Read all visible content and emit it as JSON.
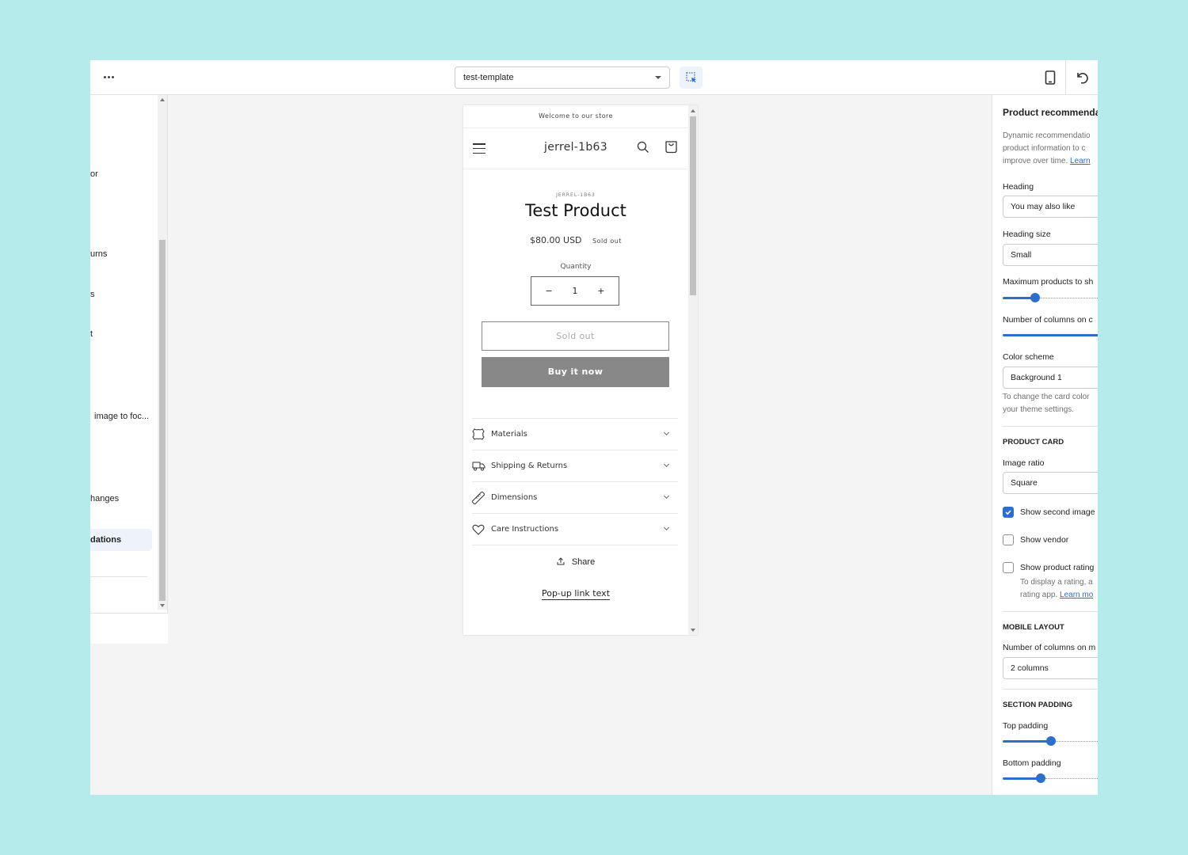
{
  "topbar": {
    "more_icon": "ellipsis-icon",
    "template_select": {
      "value": "test-template"
    },
    "inspector_icon": "select-element-icon",
    "device_icon": "mobile-device-icon",
    "undo_icon": "undo-icon"
  },
  "left_panel": {
    "items": [
      {
        "label": "or"
      },
      {
        "label": "urns"
      },
      {
        "label": "s"
      },
      {
        "label": "t"
      },
      {
        "label": "image to foc..."
      },
      {
        "label": "hanges"
      },
      {
        "label": "dations",
        "selected": true
      }
    ]
  },
  "preview": {
    "announcement": "Welcome to our store",
    "store_name": "jerrel-1b63",
    "vendor": "JERREL-1B63",
    "product_title": "Test Product",
    "price": "$80.00 USD",
    "price_badge": "Sold out",
    "quantity_label": "Quantity",
    "quantity_value": "1",
    "qty_minus": "−",
    "qty_plus": "+",
    "sold_out_button": "Sold out",
    "buy_now_button": "Buy it now",
    "accordion": [
      {
        "label": "Materials",
        "icon": "leather-icon"
      },
      {
        "label": "Shipping & Returns",
        "icon": "truck-icon"
      },
      {
        "label": "Dimensions",
        "icon": "ruler-icon"
      },
      {
        "label": "Care Instructions",
        "icon": "heart-icon"
      }
    ],
    "share_label": "Share",
    "popup_link": "Pop-up link text"
  },
  "settings": {
    "title": "Product recommenda",
    "description_lines": [
      "Dynamic recommendatio",
      "product information to c",
      "improve over time. "
    ],
    "description_link": "Learn",
    "heading_label": "Heading",
    "heading_value": "You may also like",
    "heading_size_label": "Heading size",
    "heading_size_value": "Small",
    "max_products_label": "Maximum products to sh",
    "max_products_fraction": 0.24,
    "columns_desktop_label": "Number of columns on c",
    "columns_desktop_fraction": 1.0,
    "color_scheme_label": "Color scheme",
    "color_scheme_value": "Background 1",
    "color_scheme_help_lines": [
      "To change the card color",
      "your theme settings."
    ],
    "product_card_section": "PRODUCT CARD",
    "image_ratio_label": "Image ratio",
    "image_ratio_value": "Square",
    "show_second_image_label": "Show second image",
    "show_second_image": true,
    "show_vendor_label": "Show vendor",
    "show_vendor": false,
    "show_rating_label": "Show product rating",
    "show_rating": false,
    "rating_help_line1": "To display a rating, a",
    "rating_help_line2": "rating app. ",
    "rating_help_link": "Learn mo",
    "mobile_layout_section": "MOBILE LAYOUT",
    "columns_mobile_label": "Number of columns on m",
    "columns_mobile_value": "2 columns",
    "section_padding_section": "SECTION PADDING",
    "top_padding_label": "Top padding",
    "top_padding_fraction": 0.36,
    "bottom_padding_label": "Bottom padding",
    "bottom_padding_fraction": 0.28
  },
  "colors": {
    "accent": "#2c6ecb",
    "backdrop": "#b5ebea",
    "buy_button": "#888888"
  }
}
